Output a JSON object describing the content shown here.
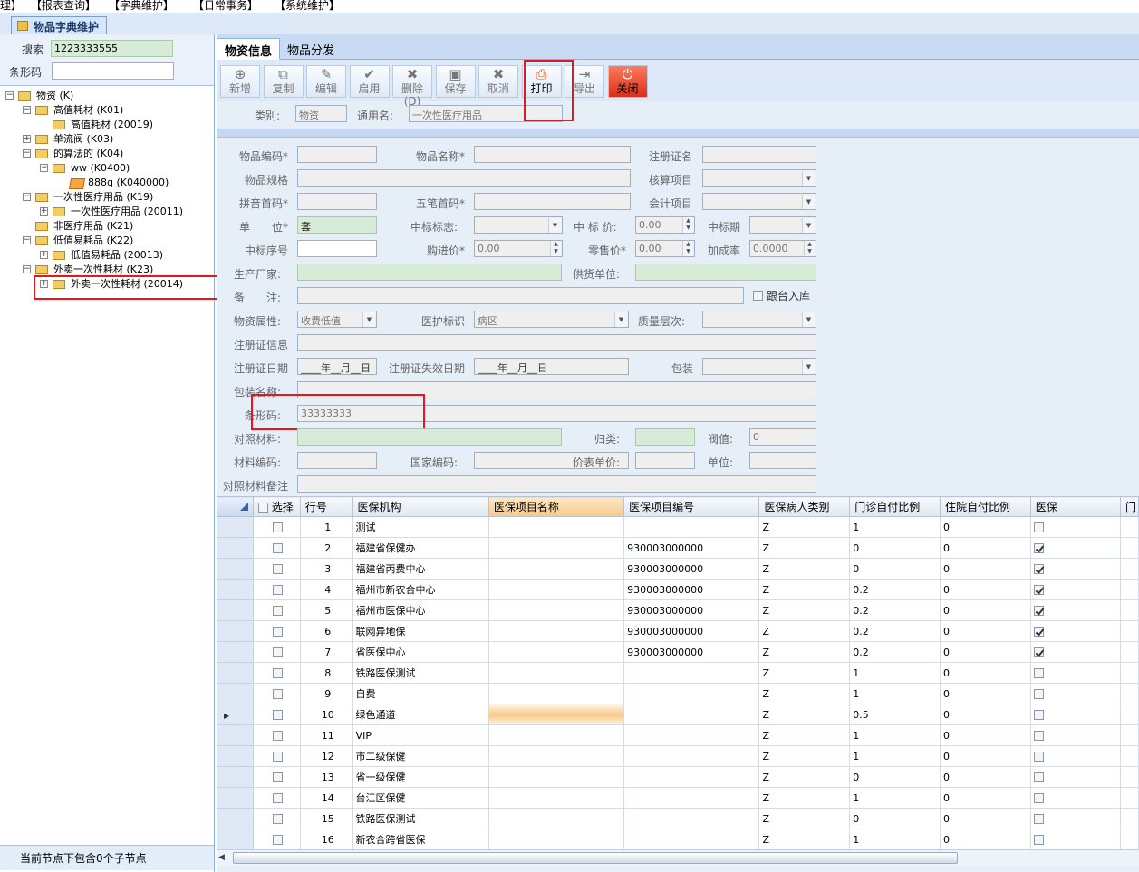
{
  "menubar": {
    "items": [
      "理】",
      "【报表查询】",
      "【字典维护】",
      "【日常事务】",
      "【系统维护】"
    ]
  },
  "doc_tab": {
    "label": "物品字典维护"
  },
  "left": {
    "search_label": "搜索",
    "search_value": "1223333555",
    "barcode_label": "条形码",
    "barcode_value": "",
    "tree": [
      {
        "label": "物资 (K)",
        "level": 0,
        "toggle": "−"
      },
      {
        "label": "高值耗材 (K01)",
        "level": 1,
        "toggle": "−"
      },
      {
        "label": "高值耗材 (20019)",
        "level": 2,
        "toggle": ""
      },
      {
        "label": "单流阀 (K03)",
        "level": 1,
        "toggle": "+"
      },
      {
        "label": "的算法的 (K04)",
        "level": 1,
        "toggle": "−"
      },
      {
        "label": "ww (K0400)",
        "level": 2,
        "toggle": "−"
      },
      {
        "label": "888g (K040000)",
        "level": 3,
        "toggle": ""
      },
      {
        "label": "一次性医疗用品 (K19)",
        "level": 1,
        "toggle": "−"
      },
      {
        "label": "一次性医疗用品 (20011)",
        "level": 2,
        "toggle": "+"
      },
      {
        "label": "非医疗用品 (K21)",
        "level": 1,
        "toggle": ""
      },
      {
        "label": "低值易耗品 (K22)",
        "level": 1,
        "toggle": "−"
      },
      {
        "label": "低值易耗品 (20013)",
        "level": 2,
        "toggle": "+"
      },
      {
        "label": "外卖一次性耗材 (K23)",
        "level": 1,
        "toggle": "−"
      },
      {
        "label": "外卖一次性耗材 (20014)",
        "level": 2,
        "toggle": "+"
      }
    ],
    "status": "当前节点下包含0个子节点"
  },
  "tabs": [
    "物资信息",
    "物品分发"
  ],
  "toolbar": [
    {
      "label": "新增",
      "icon": "add-icon",
      "glyph": "⊕",
      "enabled": false
    },
    {
      "label": "复制",
      "icon": "copy-icon",
      "glyph": "⧉",
      "enabled": false
    },
    {
      "label": "编辑",
      "icon": "edit-icon",
      "glyph": "✎",
      "enabled": false
    },
    {
      "label": "启用",
      "icon": "check-icon",
      "glyph": "✔",
      "enabled": false
    },
    {
      "label": "删除(D)",
      "icon": "delete-icon",
      "glyph": "✖",
      "enabled": false
    },
    {
      "label": "保存",
      "icon": "save-icon",
      "glyph": "▣",
      "enabled": false
    },
    {
      "label": "取消",
      "icon": "cancel-icon",
      "glyph": "✖",
      "enabled": false
    },
    {
      "label": "打印",
      "icon": "print-icon",
      "glyph": "⎙",
      "enabled": true
    },
    {
      "label": "导出",
      "icon": "export-icon",
      "glyph": "⇥",
      "enabled": false
    },
    {
      "label": "关闭",
      "icon": "power-icon",
      "glyph": "⏻",
      "enabled": true
    }
  ],
  "type_line": {
    "category_label": "类别:",
    "category_value": "物资",
    "generic_label": "通用名:",
    "generic_value": "一次性医疗用品"
  },
  "form": {
    "item_code": "物品编码*",
    "item_name": "物品名称*",
    "reg_name": "注册证名",
    "spec": "物品规格",
    "account_item": "核算项目",
    "pinyin": "拼音首码*",
    "wubi": "五笔首码*",
    "accounting_item": "会计项目",
    "unit": "单　　位*",
    "unit_value": "套",
    "bid_flag": "中标标志:",
    "bid_price": "中 标 价:",
    "bid_price_value": "0.00",
    "bid_period": "中标期",
    "bid_seq": "中标序号",
    "purchase_price": "购进价*",
    "purchase_price_value": "0.00",
    "retail_price": "零售价*",
    "retail_price_value": "0.00",
    "markup": "加成率",
    "markup_value": "0.0000",
    "manufacturer": "生产厂家:",
    "supplier": "供货单位:",
    "remark": "备　　注:",
    "follow_stock": "跟台入库",
    "property": "物资属性:",
    "property_value": "收费低值",
    "care_flag": "医护标识",
    "care_flag_value": "病区",
    "quality": "质量层次:",
    "reg_info": "注册证信息",
    "reg_date": "注册证日期",
    "reg_date_value": "____年__月__日",
    "reg_expire": "注册证失效日期",
    "reg_expire_value": "____年__月__日",
    "package": "包装",
    "package_name": "包装名称:",
    "barcode": "条形码:",
    "barcode_value": "33333333",
    "ref_material": "对照材料:",
    "category": "归类:",
    "threshold": "阀值:",
    "threshold_value": "0",
    "material_code": "材料编码:",
    "national_code": "国家编码:",
    "price_unit_price": "价表单价:",
    "unit2": "单位:",
    "ref_remark": "对照材料备注"
  },
  "grid": {
    "headers": [
      "选择",
      "行号",
      "医保机构",
      "医保项目名称",
      "医保项目编号",
      "医保病人类别",
      "门诊自付比例",
      "住院自付比例",
      "医保",
      "门"
    ],
    "rows": [
      {
        "no": "1",
        "org": "测试",
        "code": "",
        "type": "Z",
        "op": "1",
        "ip": "0",
        "ins": false
      },
      {
        "no": "2",
        "org": "福建省保健办",
        "code": "930003000000",
        "type": "Z",
        "op": "0",
        "ip": "0",
        "ins": true
      },
      {
        "no": "3",
        "org": "福建省丙费中心",
        "code": "930003000000",
        "type": "Z",
        "op": "0",
        "ip": "0",
        "ins": true
      },
      {
        "no": "4",
        "org": "福州市新农合中心",
        "code": "930003000000",
        "type": "Z",
        "op": "0.2",
        "ip": "0",
        "ins": true
      },
      {
        "no": "5",
        "org": "福州市医保中心",
        "code": "930003000000",
        "type": "Z",
        "op": "0.2",
        "ip": "0",
        "ins": true
      },
      {
        "no": "6",
        "org": "联网异地保",
        "code": "930003000000",
        "type": "Z",
        "op": "0.2",
        "ip": "0",
        "ins": true
      },
      {
        "no": "7",
        "org": "省医保中心",
        "code": "930003000000",
        "type": "Z",
        "op": "0.2",
        "ip": "0",
        "ins": true
      },
      {
        "no": "8",
        "org": "铁路医保测试",
        "code": "",
        "type": "Z",
        "op": "1",
        "ip": "0",
        "ins": false
      },
      {
        "no": "9",
        "org": "自费",
        "code": "",
        "type": "Z",
        "op": "1",
        "ip": "0",
        "ins": false
      },
      {
        "no": "10",
        "org": "绿色通道",
        "code": "",
        "type": "Z",
        "op": "0.5",
        "ip": "0",
        "ins": false
      },
      {
        "no": "11",
        "org": "VIP",
        "code": "",
        "type": "Z",
        "op": "1",
        "ip": "0",
        "ins": false
      },
      {
        "no": "12",
        "org": "市二级保健",
        "code": "",
        "type": "Z",
        "op": "1",
        "ip": "0",
        "ins": false
      },
      {
        "no": "13",
        "org": "省一级保健",
        "code": "",
        "type": "Z",
        "op": "0",
        "ip": "0",
        "ins": false
      },
      {
        "no": "14",
        "org": "台江区保健",
        "code": "",
        "type": "Z",
        "op": "1",
        "ip": "0",
        "ins": false
      },
      {
        "no": "15",
        "org": "铁路医保测试",
        "code": "",
        "type": "Z",
        "op": "0",
        "ip": "0",
        "ins": false
      },
      {
        "no": "16",
        "org": "新农合跨省医保",
        "code": "",
        "type": "Z",
        "op": "1",
        "ip": "0",
        "ins": false
      }
    ]
  }
}
